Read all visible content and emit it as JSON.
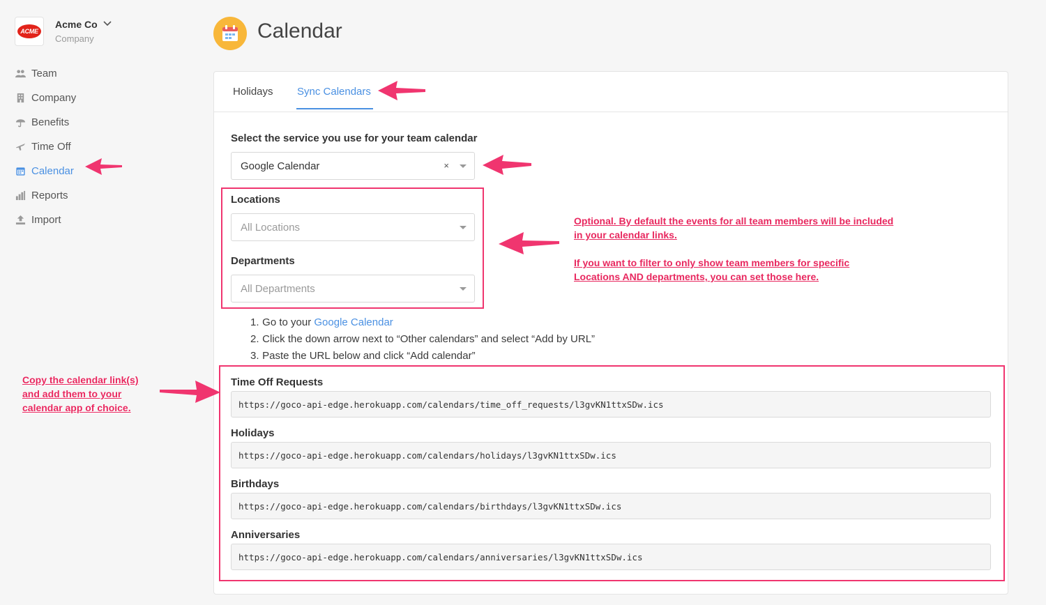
{
  "company": {
    "logo_text": "ACME",
    "name": "Acme Co",
    "subtitle": "Company"
  },
  "nav": {
    "items": [
      {
        "label": "Team",
        "icon": "team-icon"
      },
      {
        "label": "Company",
        "icon": "building-icon"
      },
      {
        "label": "Benefits",
        "icon": "umbrella-icon"
      },
      {
        "label": "Time Off",
        "icon": "plane-icon"
      },
      {
        "label": "Calendar",
        "icon": "calendar-icon",
        "active": true
      },
      {
        "label": "Reports",
        "icon": "bar-chart-icon"
      },
      {
        "label": "Import",
        "icon": "upload-icon"
      }
    ]
  },
  "page": {
    "title": "Calendar",
    "icon": "calendar-icon"
  },
  "tabs": [
    {
      "label": "Holidays",
      "active": false
    },
    {
      "label": "Sync Calendars",
      "active": true
    }
  ],
  "service": {
    "label": "Select the service you use for your team calendar",
    "value": "Google Calendar",
    "clear": "×"
  },
  "filters": {
    "locations_label": "Locations",
    "locations_placeholder": "All Locations",
    "departments_label": "Departments",
    "departments_placeholder": "All Departments"
  },
  "steps": {
    "s1_num": "1.",
    "s1_pre": "Go to your ",
    "s1_link": "Google Calendar",
    "s2_num": "2.",
    "s2": "Click the down arrow next to “Other calendars” and select “Add by URL”",
    "s3_num": "3.",
    "s3": "Paste the URL below and click “Add calendar”"
  },
  "feeds": [
    {
      "label": "Time Off Requests",
      "url": "https://goco-api-edge.herokuapp.com/calendars/time_off_requests/l3gvKN1ttxSDw.ics"
    },
    {
      "label": "Holidays",
      "url": "https://goco-api-edge.herokuapp.com/calendars/holidays/l3gvKN1ttxSDw.ics"
    },
    {
      "label": "Birthdays",
      "url": "https://goco-api-edge.herokuapp.com/calendars/birthdays/l3gvKN1ttxSDw.ics"
    },
    {
      "label": "Anniversaries",
      "url": "https://goco-api-edge.herokuapp.com/calendars/anniversaries/l3gvKN1ttxSDw.ics"
    }
  ],
  "annotations": {
    "optional_line1": "Optional.  By default the events for all team members will be included",
    "optional_line2": "in your calendar links.",
    "filter_line1": "If you want to filter to only show team members for specific",
    "filter_line2": "Locations AND departments, you can set those here.",
    "copy_line1": "Copy the calendar link(s)",
    "copy_line2": "and add them to your",
    "copy_line3": "calendar app of choice."
  },
  "colors": {
    "accent": "#4a90e2",
    "annotation": "#f0356f",
    "page_icon_bg": "#f8b73a",
    "logo_red": "#e2231a"
  }
}
